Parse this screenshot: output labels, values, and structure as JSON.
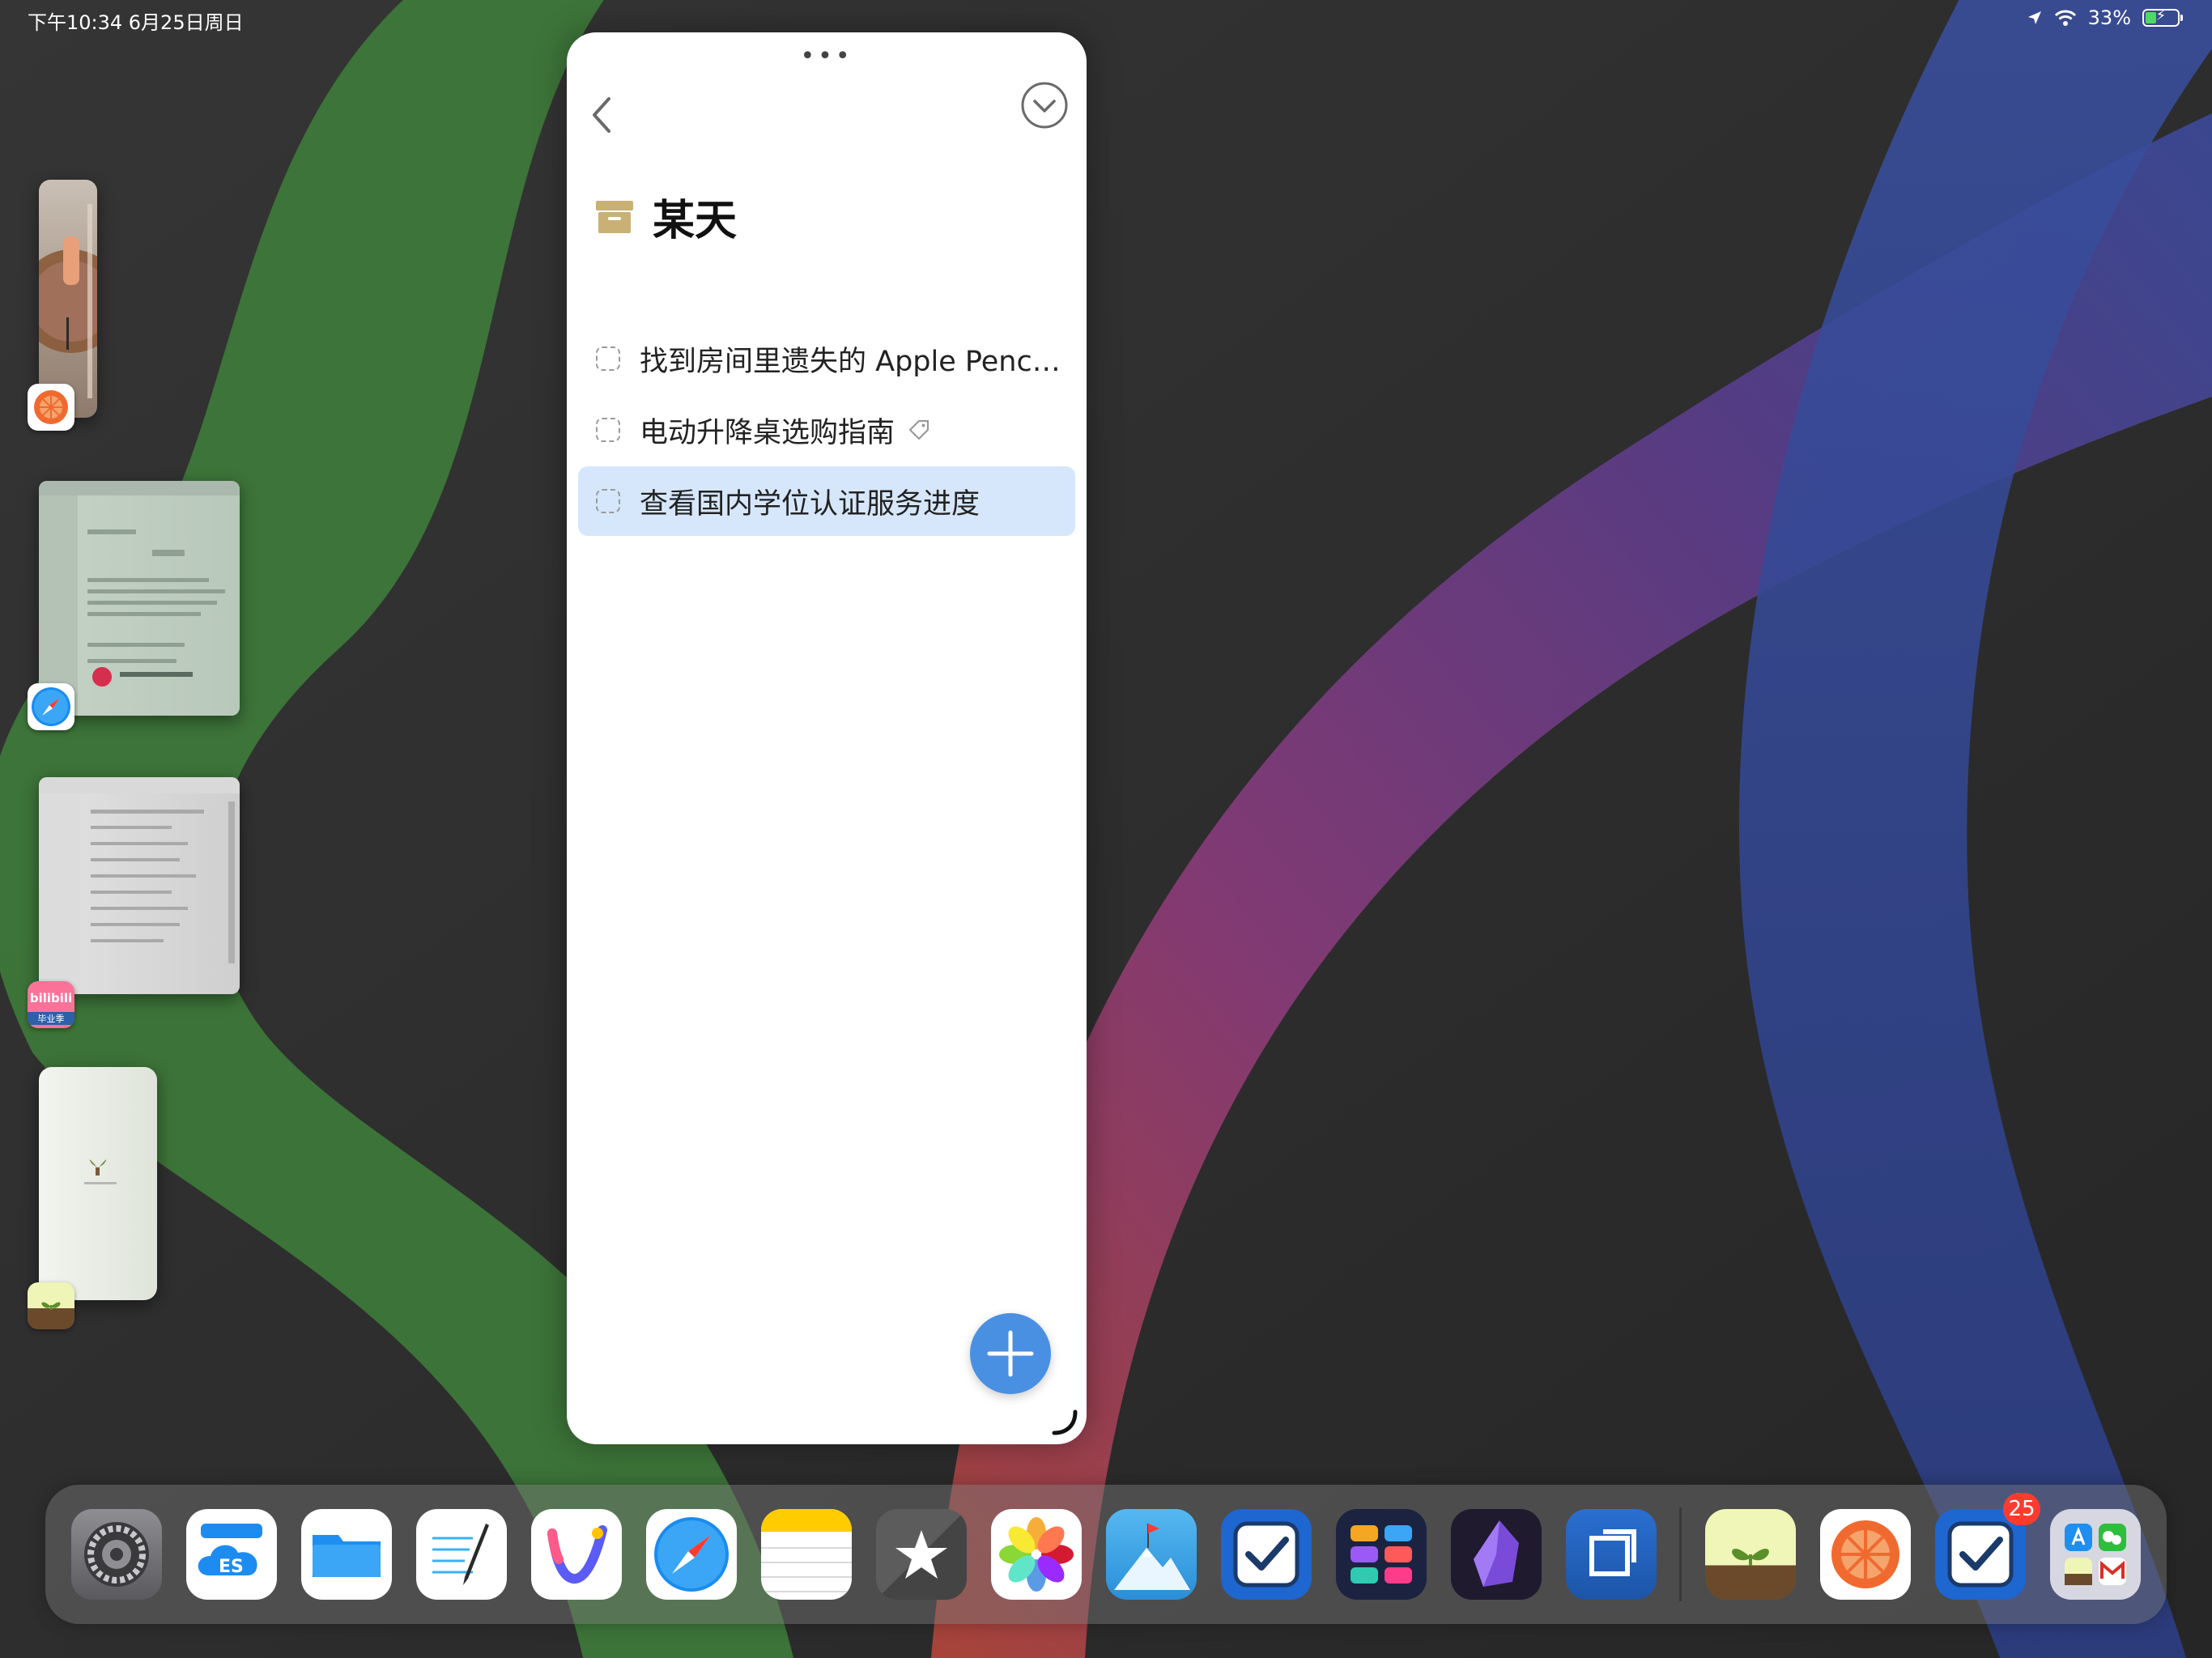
{
  "status_bar": {
    "time_date": "下午10:34   6月25日周日",
    "battery_percent": "33%",
    "battery_level": 0.33
  },
  "slide_over": {
    "list_title": "某天",
    "tasks": [
      {
        "title": "找到房间里遗失的 Apple Penci...",
        "has_tag": false,
        "selected": false
      },
      {
        "title": "电动升降桌选购指南",
        "has_tag": true,
        "selected": false
      },
      {
        "title": "查看国内学位认证服务进度",
        "has_tag": false,
        "selected": true
      }
    ]
  },
  "app_switcher": {
    "thumbnails": [
      {
        "app": "Tomato Timer",
        "icon": "tomato-icon"
      },
      {
        "app": "Safari",
        "icon": "safari-icon"
      },
      {
        "app": "bilibili",
        "icon": "bilibili-icon",
        "icon_text": "bilibili",
        "icon_sub": "毕业季"
      },
      {
        "app": "Forest",
        "icon": "forest-icon"
      }
    ]
  },
  "dock": {
    "apps": [
      "Settings",
      "ES File Explorer",
      "Files",
      "GoodNotes",
      "Vectornator",
      "Safari",
      "Notes",
      "Reeder",
      "Photos",
      "TickTick Summit",
      "Things",
      "Launcher",
      "Obsidian",
      "Screens",
      "Forest",
      "Tomato Timer",
      "Things",
      "App Library Folder"
    ],
    "badge_count": "25"
  },
  "colors": {
    "accent_blue": "#4a90e2",
    "selection": "#d6e7fb",
    "badge_red": "#ff3b30"
  }
}
